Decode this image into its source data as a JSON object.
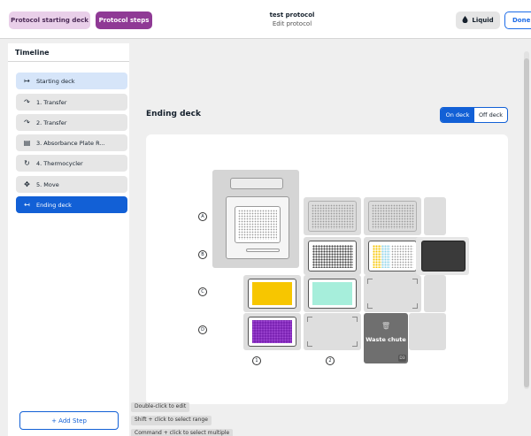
{
  "header": {
    "tab_deck": "Protocol starting deck",
    "tab_steps": "Protocol steps",
    "title": "test protocol",
    "subtitle": "Edit protocol",
    "liquid_label": "Liquid",
    "done_label": "Done"
  },
  "sidebar": {
    "title": "Timeline",
    "steps": [
      {
        "label": "Starting deck",
        "icon": "arrow-right-bar-icon"
      },
      {
        "label": "1. Transfer",
        "icon": "transfer-icon"
      },
      {
        "label": "2. Transfer",
        "icon": "transfer-icon"
      },
      {
        "label": "3. Absorbance Plate R...",
        "icon": "plate-reader-icon"
      },
      {
        "label": "4. Thermocycler",
        "icon": "thermocycler-icon"
      },
      {
        "label": "5. Move",
        "icon": "move-icon"
      },
      {
        "label": "Ending deck",
        "icon": "arrow-left-bar-icon"
      }
    ],
    "add_step": "+ Add Step"
  },
  "main": {
    "title": "Ending deck",
    "toggle_on": "On deck",
    "toggle_off": "Off deck"
  },
  "deck": {
    "rows": [
      "A",
      "B",
      "C",
      "D"
    ],
    "cols": [
      "1",
      "2",
      "3"
    ],
    "waste_chute": "Waste chute",
    "waste_slot": "D3",
    "colors": {
      "reservoir_yellow": "#f7c600",
      "reservoir_mint": "#a6eedb",
      "plate_purple": "#7a22b2",
      "dark_labware": "#3a3a3a",
      "waste": "#6f6f6f"
    }
  },
  "hints": [
    "Double-click to edit",
    "Shift + click to select range",
    "Command + click to select multiple"
  ],
  "colors": {
    "accent_blue": "#1260d6",
    "brand_purple": "#8f3a95"
  }
}
